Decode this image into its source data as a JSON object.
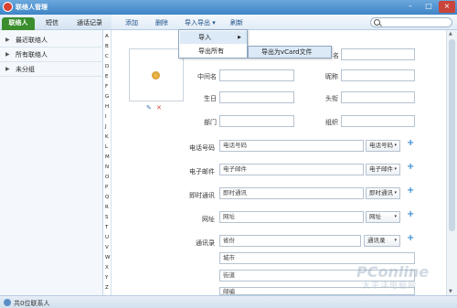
{
  "window": {
    "title": "联络人管理",
    "buttons": [
      "–",
      "□",
      "×"
    ]
  },
  "tabs": [
    "联络人",
    "短信",
    "通话记录"
  ],
  "groups": [
    {
      "label": "最近联络人"
    },
    {
      "label": "所有联络人"
    },
    {
      "label": "未分组"
    }
  ],
  "alphabet": [
    "A",
    "B",
    "C",
    "D",
    "E",
    "F",
    "G",
    "H",
    "I",
    "J",
    "K",
    "L",
    "M",
    "N",
    "O",
    "P",
    "Q",
    "R",
    "S",
    "T",
    "U",
    "V",
    "W",
    "X",
    "Y",
    "Z"
  ],
  "toolbar": {
    "add": "添加",
    "delete": "删除",
    "import_export": "导入导出",
    "import_export_caret": "▾",
    "refresh": "刷新"
  },
  "search": {
    "placeholder": "",
    "icon": "search-icon"
  },
  "menu": {
    "import": "导入",
    "import_arrow": "▶",
    "export_all": "导出所有",
    "submenu_item": "导出为vCard文件"
  },
  "photo": {
    "edit_icon": "✎",
    "delete_icon": "✕"
  },
  "form": {
    "name_label": "名",
    "middle_name_label": "中间名",
    "nickname_label": "昵称",
    "birthday_label": "生日",
    "title_label": "头衔",
    "department_label": "部门",
    "organization_label": "组织",
    "phone_label": "电话号码",
    "phone_placeholder": "电话号码",
    "phone_type": "电话号码",
    "email_label": "电子邮件",
    "email_placeholder": "电子邮件",
    "email_type": "电子邮件",
    "im_label": "即时通讯",
    "im_placeholder": "即时通讯",
    "im_type": "即时通讯",
    "web_label": "网址",
    "web_placeholder": "网址",
    "web_type": "网址",
    "address_label": "通讯录",
    "province_placeholder": "省份",
    "address_type": "通讯录",
    "city_placeholder": "城市",
    "street_placeholder": "街道",
    "postcode_placeholder": "邮编",
    "add_icon": "+",
    "caret": "▾"
  },
  "status": {
    "text": "共0位联系人"
  },
  "watermark": {
    "line1": "PConline",
    "line2": "太平洋电脑网"
  },
  "colors": {
    "accent": "#3b8e2e",
    "titlebar": "#3f84c6",
    "link": "#1b4e86"
  }
}
